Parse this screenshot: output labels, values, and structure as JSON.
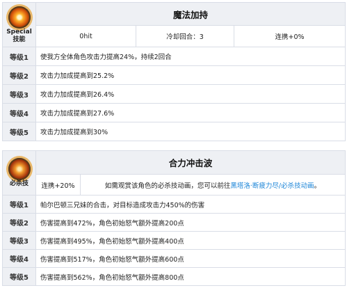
{
  "skill1": {
    "icon": "flame-orb-icon",
    "label_line1": "Special",
    "label_line2": "技能",
    "title": "魔法加持",
    "hit": "0hit",
    "cooldown": "冷却回合：3",
    "combo": "连携+0%",
    "levels": [
      {
        "label": "等级1",
        "desc": "使我方全体角色攻击力提高24%，持续2回合"
      },
      {
        "label": "等级2",
        "desc": "攻击力加成提高到25.2%"
      },
      {
        "label": "等级3",
        "desc": "攻击力加成提高到26.4%"
      },
      {
        "label": "等级4",
        "desc": "攻击力加成提高到27.6%"
      },
      {
        "label": "等级5",
        "desc": "攻击力加成提高到30%"
      }
    ]
  },
  "skill2": {
    "icon": "explosion-orb-icon",
    "label": "必杀技",
    "title": "合力冲击波",
    "combo": "连携+20%",
    "note_prefix": "如需观赏该角色的必杀技动画，您可以前往",
    "note_link": "黑塔洛·断疲力尽/必杀技动画",
    "note_suffix": "。",
    "levels": [
      {
        "label": "等级1",
        "desc": "帕尔巴顿三兄妹的合击，对目标造成攻击力450%的伤害"
      },
      {
        "label": "等级2",
        "desc": "伤害提高到472%，角色初始怒气额外提高200点"
      },
      {
        "label": "等级3",
        "desc": "伤害提高到495%，角色初始怒气额外提高400点"
      },
      {
        "label": "等级4",
        "desc": "伤害提高到517%，角色初始怒气额外提高600点"
      },
      {
        "label": "等级5",
        "desc": "伤害提高到562%，角色初始怒气额外提高800点"
      }
    ]
  },
  "colors": {
    "border": "#d9dde6",
    "label_bg": "#eef0f4",
    "link": "#1e86d8"
  }
}
